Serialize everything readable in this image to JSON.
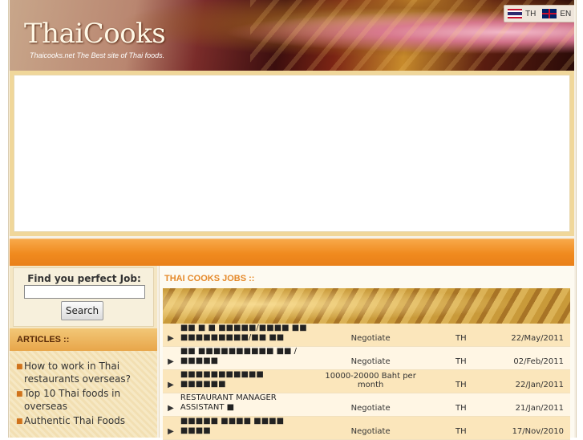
{
  "header": {
    "logo": "ThaiCooks",
    "tagline": "Thaicooks.net  The Best site of Thai foods.",
    "languages": [
      {
        "code": "TH",
        "flag": "thailand-flag-icon"
      },
      {
        "code": "EN",
        "flag": "uk-flag-icon"
      }
    ]
  },
  "search": {
    "title": "Find you perfect Job:",
    "placeholder": "",
    "value": "",
    "button_label": "Search"
  },
  "articles": {
    "heading": "ARTICLES ::",
    "items": [
      "How to work in Thai restaurants overseas?",
      "Top 10 Thai foods in overseas",
      "Authentic Thai Foods"
    ]
  },
  "jobs": {
    "heading": "THAI COOKS JOBS ::",
    "rows": [
      {
        "title": "■■ ■ ■ ■■■■■/■■■■ ■■ ■■■■■■■■■/■■ ■■",
        "salary": "Negotiate",
        "location": "TH",
        "date": "22/May/2011"
      },
      {
        "title": "■■ ■■■■■■■■■■ ■■ /■■■■■",
        "salary": "Negotiate",
        "location": "TH",
        "date": "02/Feb/2011"
      },
      {
        "title": "■■■■■■■■■■■ ■■■■■■",
        "salary": "10000-20000 Baht per month",
        "location": "TH",
        "date": "22/Jan/2011"
      },
      {
        "title": "RESTAURANT MANAGER ASSISTANT ■",
        "salary": "Negotiate",
        "location": "TH",
        "date": "21/Jan/2011"
      },
      {
        "title": "■■■■■ ■■■■ ■■■■ ■■■■",
        "salary": "Negotiate",
        "location": "TH",
        "date": "17/Nov/2010"
      }
    ]
  },
  "colors": {
    "accent_orange": "#f08a1e",
    "heading_orange": "#e5892a",
    "arrow": "#e27d18"
  }
}
